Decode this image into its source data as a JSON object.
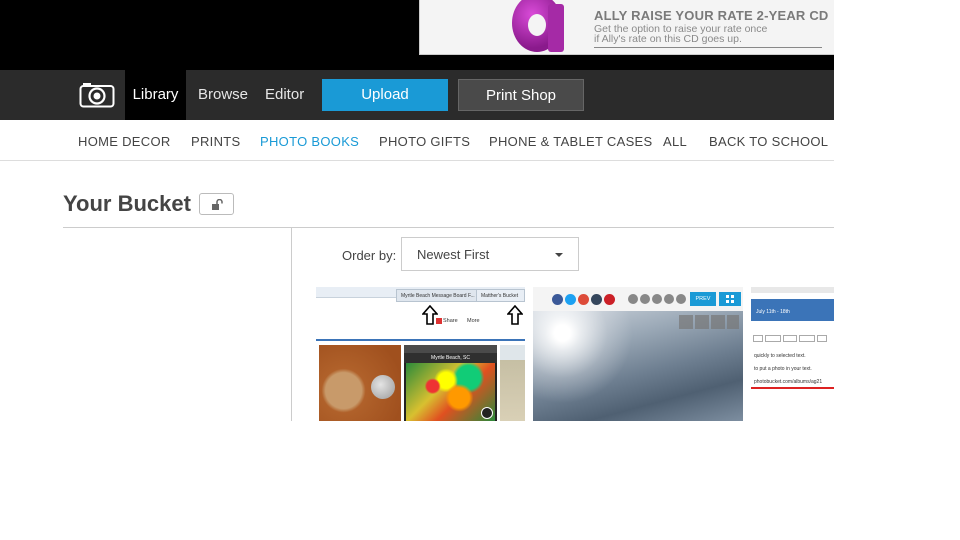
{
  "ad": {
    "headline": "ALLY RAISE YOUR RATE 2-YEAR CD",
    "line1": "Get the option to raise your rate once",
    "line2": "if Ally's rate on this CD goes up."
  },
  "nav": {
    "library": "Library",
    "browse": "Browse",
    "editor": "Editor",
    "upload": "Upload",
    "print_shop": "Print Shop"
  },
  "categories": [
    {
      "label": "HOME DECOR",
      "active": false
    },
    {
      "label": "PRINTS",
      "active": false
    },
    {
      "label": "PHOTO BOOKS",
      "active": true
    },
    {
      "label": "PHOTO GIFTS",
      "active": false
    },
    {
      "label": "PHONE & TABLET CASES",
      "active": false
    },
    {
      "label": "ALL",
      "active": false
    },
    {
      "label": "BACK TO SCHOOL",
      "active": false
    }
  ],
  "bucket": {
    "title": "Your Bucket",
    "order_label": "Order by:",
    "order_value": "Newest First"
  },
  "thumbnails": {
    "t1": {
      "tab1": "Myrtle Beach Message Board F...",
      "tab2": "Matther's Bucket",
      "share": "Share",
      "more": "More",
      "phone_title": "Myrtle Beach, SC"
    },
    "t2": {
      "prev": "PREV"
    },
    "t3": {
      "line1": "July 11th - 18th",
      "line2": "quickly to selected text.",
      "line3": "to put a photo in your text.",
      "line4": "photobucket.com/albums/ag21"
    }
  },
  "colors": {
    "accent": "#1a9ad6",
    "nav_bg": "#2b2b2b",
    "ad_brand": "#a52aa6"
  }
}
